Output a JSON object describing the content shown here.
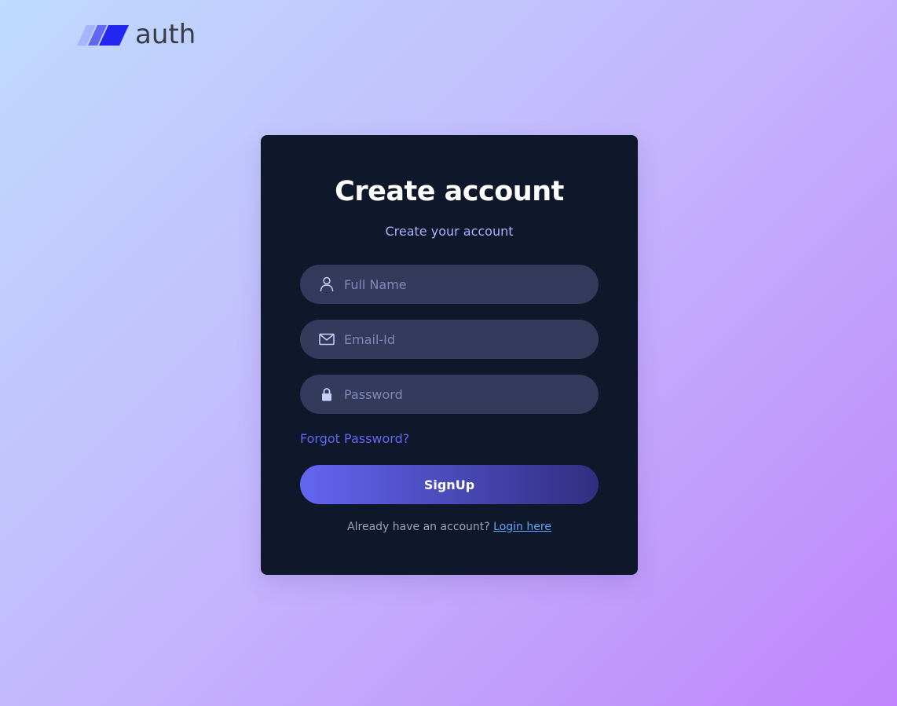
{
  "brand": {
    "name": "auth"
  },
  "form": {
    "title": "Create account",
    "subtitle": "Create your account",
    "fields": {
      "name": {
        "placeholder": "Full Name",
        "value": "",
        "icon": "person-icon"
      },
      "email": {
        "placeholder": "Email-Id",
        "value": "",
        "icon": "mail-icon"
      },
      "password": {
        "placeholder": "Password",
        "value": "",
        "icon": "lock-icon"
      }
    },
    "forgot_label": "Forgot Password?",
    "submit_label": "SignUp",
    "login_prompt": "Already have an account?",
    "login_link": "Login here"
  },
  "colors": {
    "card_bg": "#0f172a",
    "input_bg": "#333a5c",
    "accent": "#6366f1",
    "subtitle": "#a5b4fc",
    "link": "#60a5fa"
  }
}
